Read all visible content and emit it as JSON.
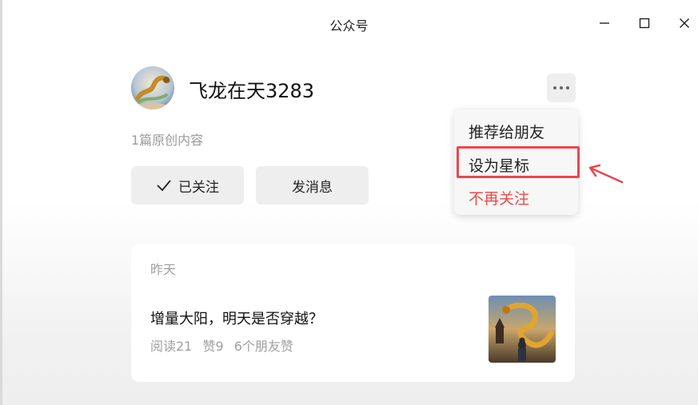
{
  "window": {
    "title": "公众号"
  },
  "account": {
    "name": "飞龙在天3283",
    "original_count": "1篇原创内容",
    "follow_button": "已关注",
    "message_button": "发消息"
  },
  "menu": {
    "recommend": "推荐给朋友",
    "star": "设为星标",
    "unfollow": "不再关注"
  },
  "article": {
    "date": "昨天",
    "title": "增量大阳，明天是否穿越？",
    "reads": "阅读21",
    "likes": "赞9",
    "friends": "6个朋友赞"
  },
  "colors": {
    "unfollow": "#e84a4a",
    "highlight": "#e8484f",
    "button_bg": "#eeeeee"
  },
  "icons": [
    "minimize-icon",
    "maximize-icon",
    "close-icon",
    "more-icon",
    "check-icon",
    "pointer-arrow-icon"
  ]
}
